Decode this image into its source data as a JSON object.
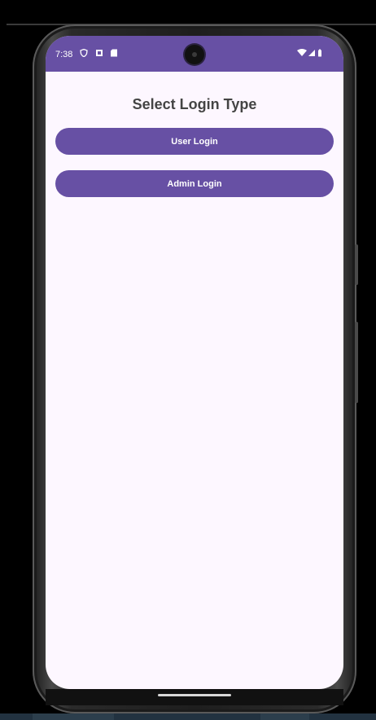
{
  "status_bar": {
    "time": "7:38",
    "left_icons": [
      "shield-icon",
      "notification-icon",
      "sd-card-icon"
    ],
    "right_icons": [
      "wifi-icon",
      "signal-icon",
      "battery-icon"
    ],
    "background": "#6750a4"
  },
  "screen": {
    "title": "Select Login Type",
    "buttons": [
      {
        "label": "User Login"
      },
      {
        "label": "Admin Login"
      }
    ],
    "background": "#fdf7ff",
    "accent": "#6750a4"
  }
}
